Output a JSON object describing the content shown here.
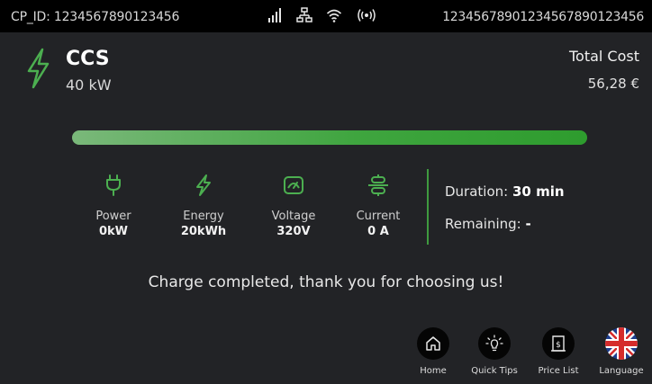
{
  "status_bar": {
    "cp_id": "CP_ID: 1234567890123456",
    "serial": "12345678901234567890123456",
    "icons": [
      "signal-icon",
      "network-icon",
      "wifi-icon",
      "rfid-icon"
    ]
  },
  "connector": {
    "type": "CCS",
    "power": "40 kW",
    "icon": "lightning-icon"
  },
  "cost": {
    "label": "Total Cost",
    "value": "56,28 €"
  },
  "progress": {
    "fraction": 1.0
  },
  "metrics": [
    {
      "icon": "plug-icon",
      "label": "Power",
      "value": "0kW"
    },
    {
      "icon": "lightning-icon",
      "label": "Energy",
      "value": "20kWh"
    },
    {
      "icon": "gauge-icon",
      "label": "Voltage",
      "value": "320V"
    },
    {
      "icon": "current-icon",
      "label": "Current",
      "value": "0 A"
    }
  ],
  "session": {
    "duration_label": "Duration:",
    "duration_value": "30 min",
    "remaining_label": "Remaining:",
    "remaining_value": "-"
  },
  "message": "Charge completed, thank you for choosing us!",
  "nav": [
    {
      "icon": "home-icon",
      "label": "Home"
    },
    {
      "icon": "lightbulb-icon",
      "label": "Quick Tips"
    },
    {
      "icon": "price-list-icon",
      "label": "Price List"
    },
    {
      "icon": "uk-flag-icon",
      "label": "Language"
    }
  ],
  "colors": {
    "accent_green": "#3fa53f",
    "background": "#222326",
    "status_bar": "#000000"
  }
}
